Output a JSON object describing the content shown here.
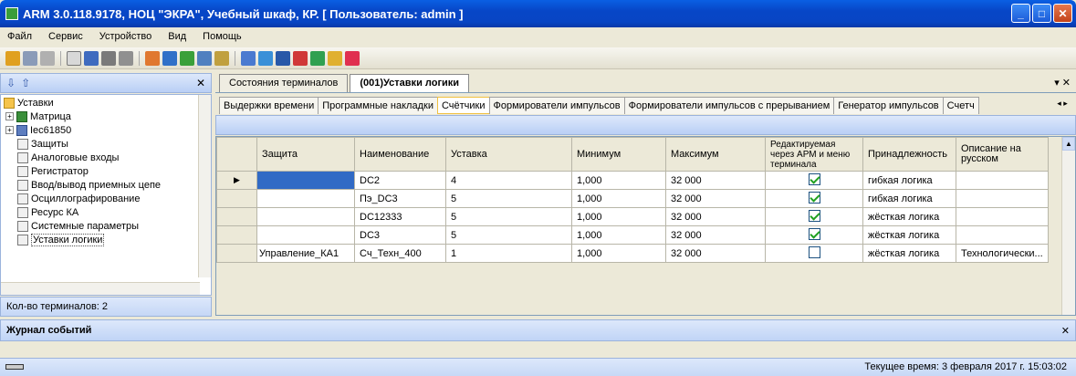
{
  "window": {
    "title": "ARM 3.0.118.9178, НОЦ \"ЭКРА\", Учебный шкаф, КР. [ Пользователь: admin ]"
  },
  "menu": [
    "Файл",
    "Сервис",
    "Устройство",
    "Вид",
    "Помощь"
  ],
  "tree": {
    "items": [
      "Уставки",
      "Матрица",
      "Iec61850",
      "Защиты",
      "Аналоговые входы",
      "Регистратор",
      "Ввод/вывод приемных цепе",
      "Осциллографирование",
      "Ресурс КА",
      "Системные параметры",
      "Уставки логики"
    ]
  },
  "left_status": "Кол-во терминалов: 2",
  "doc_tabs": [
    "Состояния терминалов",
    "(001)Уставки логики"
  ],
  "sub_tabs": [
    "Выдержки времени",
    "Программные накладки",
    "Счётчики",
    "Формирователи импульсов",
    "Формирователи импульсов с прерыванием",
    "Генератор импульсов",
    "Счетч"
  ],
  "grid": {
    "headers": [
      "Защита",
      "Наименование",
      "Уставка",
      "Минимум",
      "Максимум",
      "Редактируемая через АРМ и меню терминала",
      "Принадлежность",
      "Описание на русском"
    ],
    "rows": [
      {
        "zashita": "",
        "name": "DC2",
        "ustavka": "4",
        "min": "1,000",
        "max": "32 000",
        "editable": true,
        "belong": "гибкая логика",
        "desc": ""
      },
      {
        "zashita": "",
        "name": "Пэ_DC3",
        "ustavka": "5",
        "min": "1,000",
        "max": "32 000",
        "editable": true,
        "belong": "гибкая логика",
        "desc": ""
      },
      {
        "zashita": "",
        "name": "DC12333",
        "ustavka": "5",
        "min": "1,000",
        "max": "32 000",
        "editable": true,
        "belong": "жёсткая логика",
        "desc": ""
      },
      {
        "zashita": "",
        "name": "DC3",
        "ustavka": "5",
        "min": "1,000",
        "max": "32 000",
        "editable": true,
        "belong": "жёсткая логика",
        "desc": ""
      },
      {
        "zashita": "Управление_КА1",
        "name": "Сч_Техн_400",
        "ustavka": "1",
        "min": "1,000",
        "max": "32 000",
        "editable": false,
        "belong": "жёсткая логика",
        "desc": "Технологически..."
      }
    ]
  },
  "events_title": "Журнал событий",
  "status_time": "Текущее время: 3 февраля 2017 г. 15:03:02",
  "colors": {
    "title_bar": "#0A5FE3",
    "selection": "#316AC5",
    "panel": "#ECE9D8"
  }
}
